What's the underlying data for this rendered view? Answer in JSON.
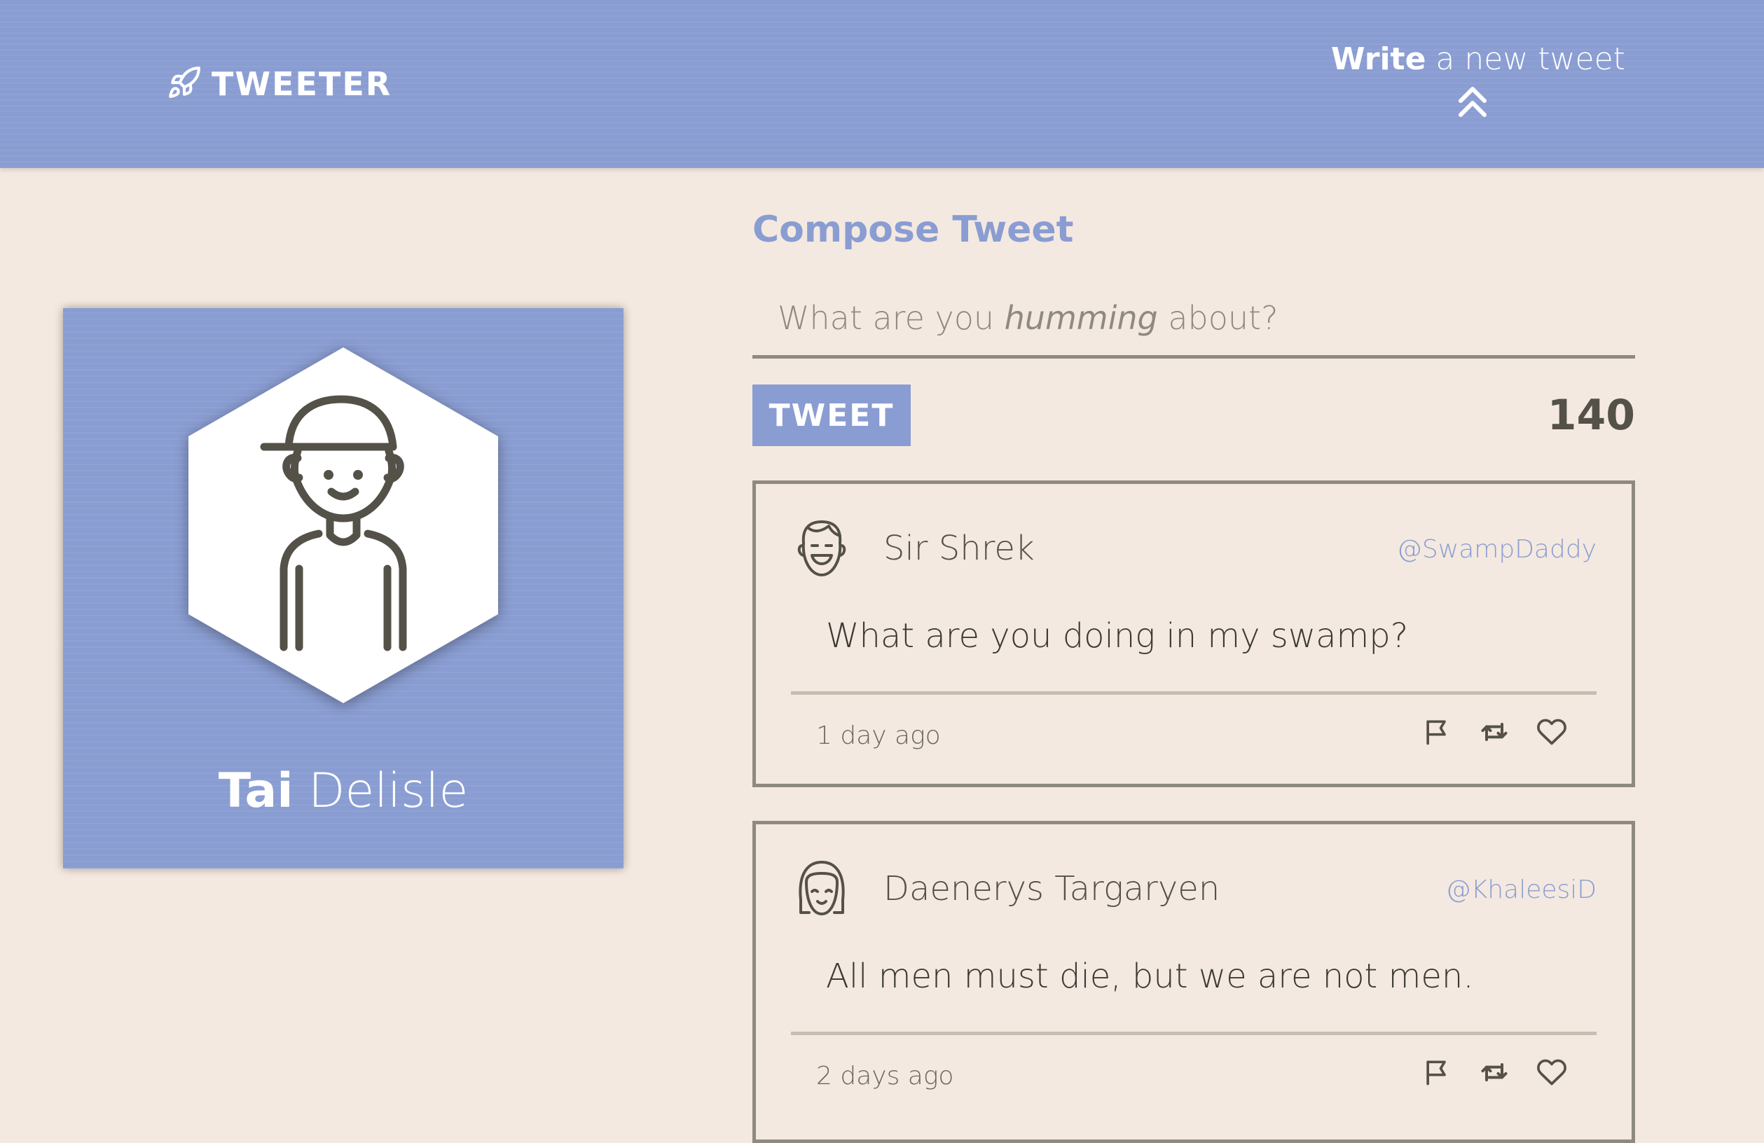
{
  "nav": {
    "brand": "TWEETER",
    "compose_bold": "Write",
    "compose_rest": " a new tweet"
  },
  "profile": {
    "first_name": "Tai",
    "last_name": " Delisle"
  },
  "compose": {
    "title": "Compose Tweet",
    "placeholder_before": "What are you ",
    "placeholder_em": "humming",
    "placeholder_after": " about?",
    "button_label": "TWEET",
    "counter": "140"
  },
  "tweets": [
    {
      "name": "Sir Shrek",
      "handle": "@SwampDaddy",
      "text": "What are you doing in my swamp?",
      "time": "1 day ago",
      "avatar_icon": "smiling-man-avatar-icon"
    },
    {
      "name": "Daenerys Targaryen",
      "handle": "@KhaleesiD",
      "text": "All men must die, but we are not men.",
      "time": "2 days ago",
      "avatar_icon": "girl-avatar-icon"
    }
  ],
  "colors": {
    "accent": "#8a9dd2",
    "background": "#f4e9e0",
    "text": "#545149",
    "border": "#8f8a80"
  }
}
